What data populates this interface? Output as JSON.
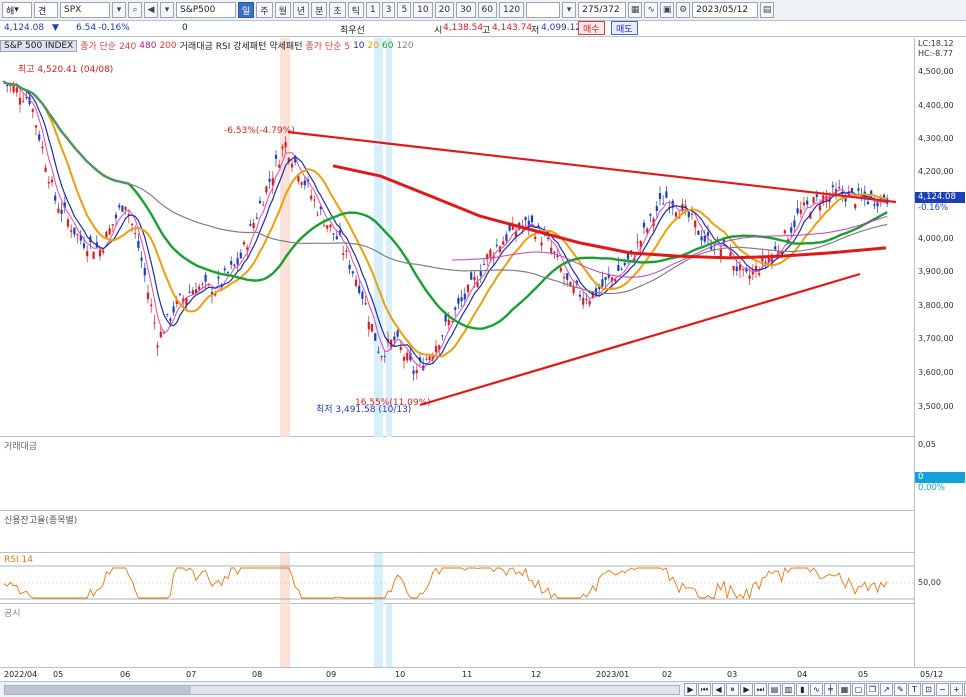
{
  "toolbar": {
    "mode": "해",
    "market": "견",
    "symbol": "SPX",
    "symbol_name": "S&P500",
    "periods": [
      "일",
      "주",
      "월",
      "년",
      "분",
      "초",
      "틱"
    ],
    "period_active": 0,
    "intervals": [
      "1",
      "3",
      "5",
      "10",
      "20",
      "30",
      "60",
      "120"
    ],
    "count": "275/372",
    "date": "2023/05/12"
  },
  "quote": {
    "price": "4,124.08",
    "change": "6.54",
    "change_pct": "-0.16%",
    "volume": "0",
    "best": "최우선",
    "open_label": "시",
    "open": "4,138.54",
    "high_label": "고",
    "high": "4,143.74",
    "low_label": "저",
    "low": "4,099.12",
    "buy": "매수",
    "sell": "매도"
  },
  "price_panel": {
    "title": "S&P 500 INDEX",
    "legend_ma1": "종가 단순 240",
    "legend_ma1_b": "480",
    "legend_ma1_c": "200",
    "legend_vol": "거래대금",
    "legend_rsi": "RSI 강세패턴",
    "legend_rsi_b": "약세패턴",
    "legend_ma2": "종가 단순 5",
    "ma2_periods": [
      "10",
      "20",
      "60",
      "120"
    ],
    "lc": "LC:18.12",
    "hc": "HC:-8.77",
    "high_note": "최고 4,520.41 (04/08)",
    "low_note": "최저 3,491.58 (10/13)",
    "drop_note": "-6.53%(-4.79%)",
    "low_pct": "16.55%(11.09%)",
    "price_tag": "4,124.08",
    "price_tag_pct": "-0.16%",
    "yticks": [
      "4,500,00",
      "4,400,00",
      "4,300,00",
      "4,200,00",
      "4,000,00",
      "3,900,00",
      "3,800,00",
      "3,700,00",
      "3,600,00",
      "3,500,00"
    ]
  },
  "volume_panel": {
    "title": "거래대금",
    "ytick": "0,05",
    "tag_value": "0",
    "tag_pct": "0.00%"
  },
  "credit_panel": {
    "title": "신용잔고율(종목별)"
  },
  "rsi_panel": {
    "title": "RSI 14",
    "ytick": "50,00"
  },
  "notice_panel": {
    "title": "공시"
  },
  "xaxis": {
    "labels": [
      "2022/04",
      "05",
      "06",
      "07",
      "08",
      "09",
      "10",
      "11",
      "12",
      "2023/01",
      "02",
      "03",
      "04",
      "05",
      "05/12"
    ]
  },
  "colors": {
    "up": "#d42020",
    "down": "#1a3fb8",
    "ma5": "#e048b0",
    "ma10": "#1a2fa8",
    "ma20": "#e8a010",
    "ma60": "#18a030",
    "ma120": "#808080",
    "trend": "#e01818"
  }
}
